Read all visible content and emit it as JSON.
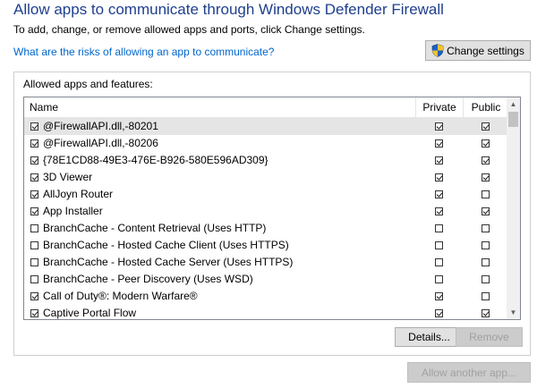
{
  "header": {
    "title": "Allow apps to communicate through Windows Defender Firewall",
    "subtitle": "To add, change, or remove allowed apps and ports, click Change settings.",
    "risk_link": "What are the risks of allowing an app to communicate?",
    "change_settings_label": "Change settings"
  },
  "group": {
    "label": "Allowed apps and features:",
    "columns": {
      "name": "Name",
      "private": "Private",
      "public": "Public"
    },
    "rows": [
      {
        "name": "@FirewallAPI.dll,-80201",
        "enabled": true,
        "private": true,
        "public": true,
        "selected": true
      },
      {
        "name": "@FirewallAPI.dll,-80206",
        "enabled": true,
        "private": true,
        "public": true,
        "selected": false
      },
      {
        "name": "{78E1CD88-49E3-476E-B926-580E596AD309}",
        "enabled": true,
        "private": true,
        "public": true,
        "selected": false
      },
      {
        "name": "3D Viewer",
        "enabled": true,
        "private": true,
        "public": true,
        "selected": false
      },
      {
        "name": "AllJoyn Router",
        "enabled": true,
        "private": true,
        "public": false,
        "selected": false
      },
      {
        "name": "App Installer",
        "enabled": true,
        "private": true,
        "public": true,
        "selected": false
      },
      {
        "name": "BranchCache - Content Retrieval (Uses HTTP)",
        "enabled": false,
        "private": false,
        "public": false,
        "selected": false
      },
      {
        "name": "BranchCache - Hosted Cache Client (Uses HTTPS)",
        "enabled": false,
        "private": false,
        "public": false,
        "selected": false
      },
      {
        "name": "BranchCache - Hosted Cache Server (Uses HTTPS)",
        "enabled": false,
        "private": false,
        "public": false,
        "selected": false
      },
      {
        "name": "BranchCache - Peer Discovery (Uses WSD)",
        "enabled": false,
        "private": false,
        "public": false,
        "selected": false
      },
      {
        "name": "Call of Duty®: Modern Warfare®",
        "enabled": true,
        "private": true,
        "public": false,
        "selected": false
      },
      {
        "name": "Captive Portal Flow",
        "enabled": true,
        "private": true,
        "public": true,
        "selected": false
      }
    ],
    "details_label": "Details...",
    "remove_label": "Remove"
  },
  "footer": {
    "allow_another_label": "Allow another app..."
  },
  "colors": {
    "title": "#1e3f8e",
    "link": "#0066cc",
    "selected_row": "#e5e5e5"
  }
}
